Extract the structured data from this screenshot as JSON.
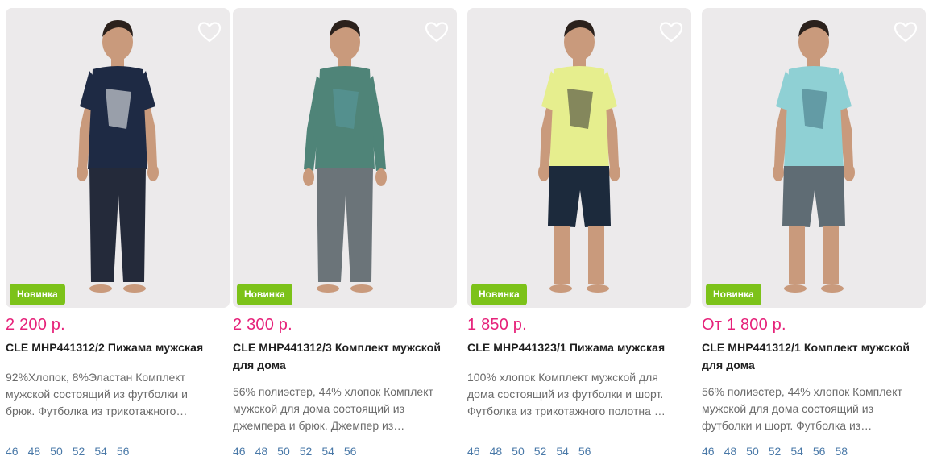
{
  "products": [
    {
      "price": "2 200 р.",
      "title_line1": "CLE МНР441312/2 Пижама мужская",
      "title_line2": "",
      "badge": "Новинка",
      "desc": [
        "92%Хлопок, 8%Эластан Комплект",
        "мужской состоящий из футболки и",
        "брюк. Футболка из трикотажного…"
      ],
      "sizes": [
        "46",
        "48",
        "50",
        "52",
        "54",
        "56"
      ],
      "colors": {
        "top": "#1e2a44",
        "bottom": "#242a3a",
        "accent": "#ffffff"
      }
    },
    {
      "price": "2 300 р.",
      "title_line1": "CLE МНР441312/3 Комплект мужской",
      "title_line2": "для дома",
      "badge": "Новинка",
      "desc": [
        "56% полиэстер, 44% хлопок Комплект",
        "мужской для дома состоящий из",
        "джемпера и брюк. Джемпер из…"
      ],
      "sizes": [
        "46",
        "48",
        "50",
        "52",
        "54",
        "56"
      ],
      "colors": {
        "top": "#4f8478",
        "bottom": "#6b7479",
        "accent": "#5a9aa0"
      }
    },
    {
      "price": "1 850 р.",
      "title_line1": "CLE МНР441323/1 Пижама мужская",
      "title_line2": "",
      "badge": "Новинка",
      "desc": [
        "100% хлопок Комплект мужской для",
        "дома состоящий из футболки и шорт.",
        "Футболка из трикотажного полотна …"
      ],
      "sizes": [
        "46",
        "48",
        "50",
        "52",
        "54",
        "56"
      ],
      "colors": {
        "top": "#e6ee8e",
        "bottom": "#1c2a3c",
        "accent": "#333333"
      }
    },
    {
      "price": "От 1 800 р.",
      "title_line1": "CLE МНР441312/1 Комплект мужской",
      "title_line2": "для дома",
      "badge": "Новинка",
      "desc": [
        "56% полиэстер, 44% хлопок Комплект",
        "мужской для дома состоящий из",
        "футболки и шорт. Футболка из…"
      ],
      "sizes": [
        "46",
        "48",
        "50",
        "52",
        "54",
        "56",
        "58"
      ],
      "colors": {
        "top": "#8fd0d4",
        "bottom": "#5f6c74",
        "accent": "#3f6f7d"
      }
    }
  ]
}
